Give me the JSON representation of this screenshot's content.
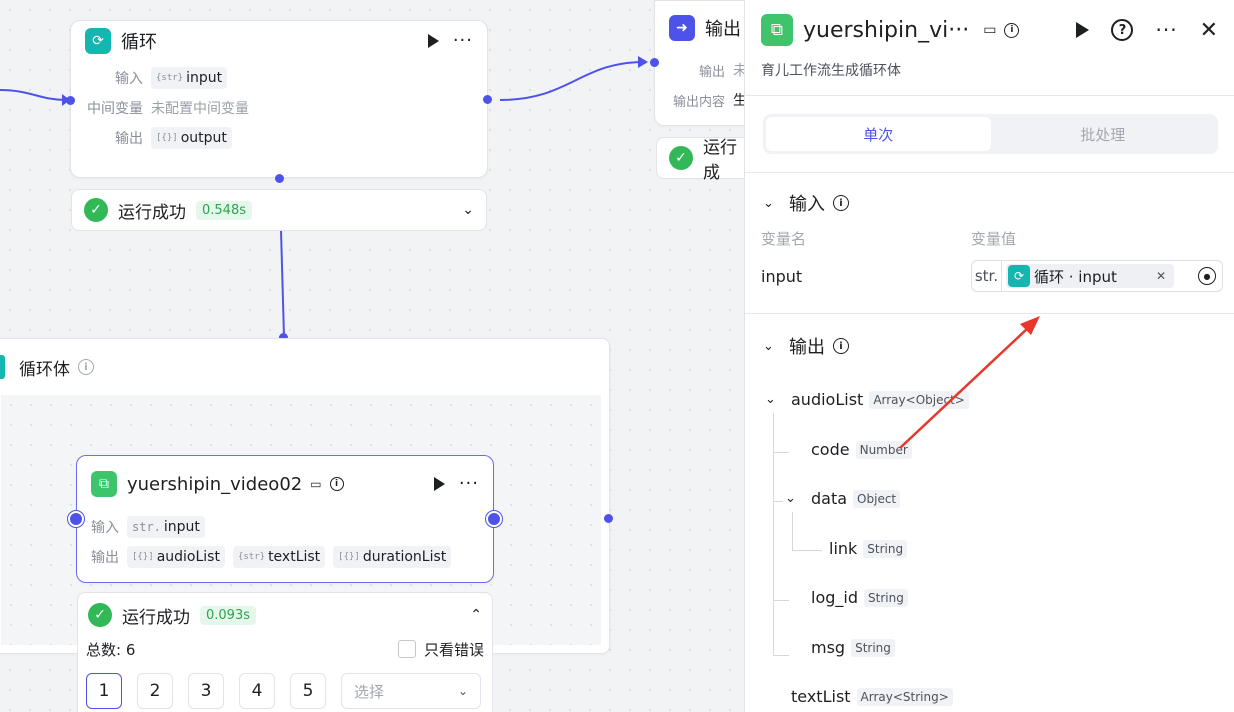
{
  "loop_node": {
    "title": "循环",
    "input_label": "输入",
    "input_type": "{str}",
    "input_value": "input",
    "mid_label": "中间变量",
    "mid_value": "未配置中间变量",
    "output_label": "输出",
    "output_type": "[{}]",
    "output_value": "output"
  },
  "loop_status": {
    "text": "运行成功",
    "time": "0.548s"
  },
  "output_node": {
    "title": "输出",
    "row1_label": "输出",
    "row1_value": "未",
    "row2_label": "输出内容",
    "row2_value": "生"
  },
  "output_status": {
    "text": "运行成"
  },
  "loop_body": {
    "title": "循环体"
  },
  "video_node": {
    "title": "yuershipin_video02",
    "input_label": "输入",
    "input_type": "str.",
    "input_value": "input",
    "output_label": "输出",
    "out1_type": "[{}]",
    "out1": "audioList",
    "out2_type": "{str}",
    "out2": "textList",
    "out3_type": "[{}]",
    "out3": "durationList"
  },
  "video_status": {
    "text": "运行成功",
    "time": "0.093s",
    "total": "总数: 6",
    "errors_only": "只看错误",
    "pages": [
      "1",
      "2",
      "3",
      "4",
      "5"
    ],
    "select_placeholder": "选择"
  },
  "panel": {
    "title": "yuershipin_vi···",
    "description": "育儿工作流生成循环体",
    "tab_single": "单次",
    "tab_batch": "批处理",
    "input_section": "输入",
    "col_name": "变量名",
    "col_value": "变量值",
    "var_name": "input",
    "var_type": "str.",
    "var_ref": "循环 · input",
    "output_section": "输出",
    "tree": [
      {
        "name": "audioList",
        "type": "Array<Object>"
      },
      {
        "name": "code",
        "type": "Number"
      },
      {
        "name": "data",
        "type": "Object"
      },
      {
        "name": "link",
        "type": "String"
      },
      {
        "name": "log_id",
        "type": "String"
      },
      {
        "name": "msg",
        "type": "String"
      },
      {
        "name": "textList",
        "type": "Array<String>"
      }
    ]
  },
  "colors": {
    "accent": "#4d53e8",
    "success": "#32b857",
    "teal": "#16b6b0",
    "annotation": "#e8362a"
  }
}
